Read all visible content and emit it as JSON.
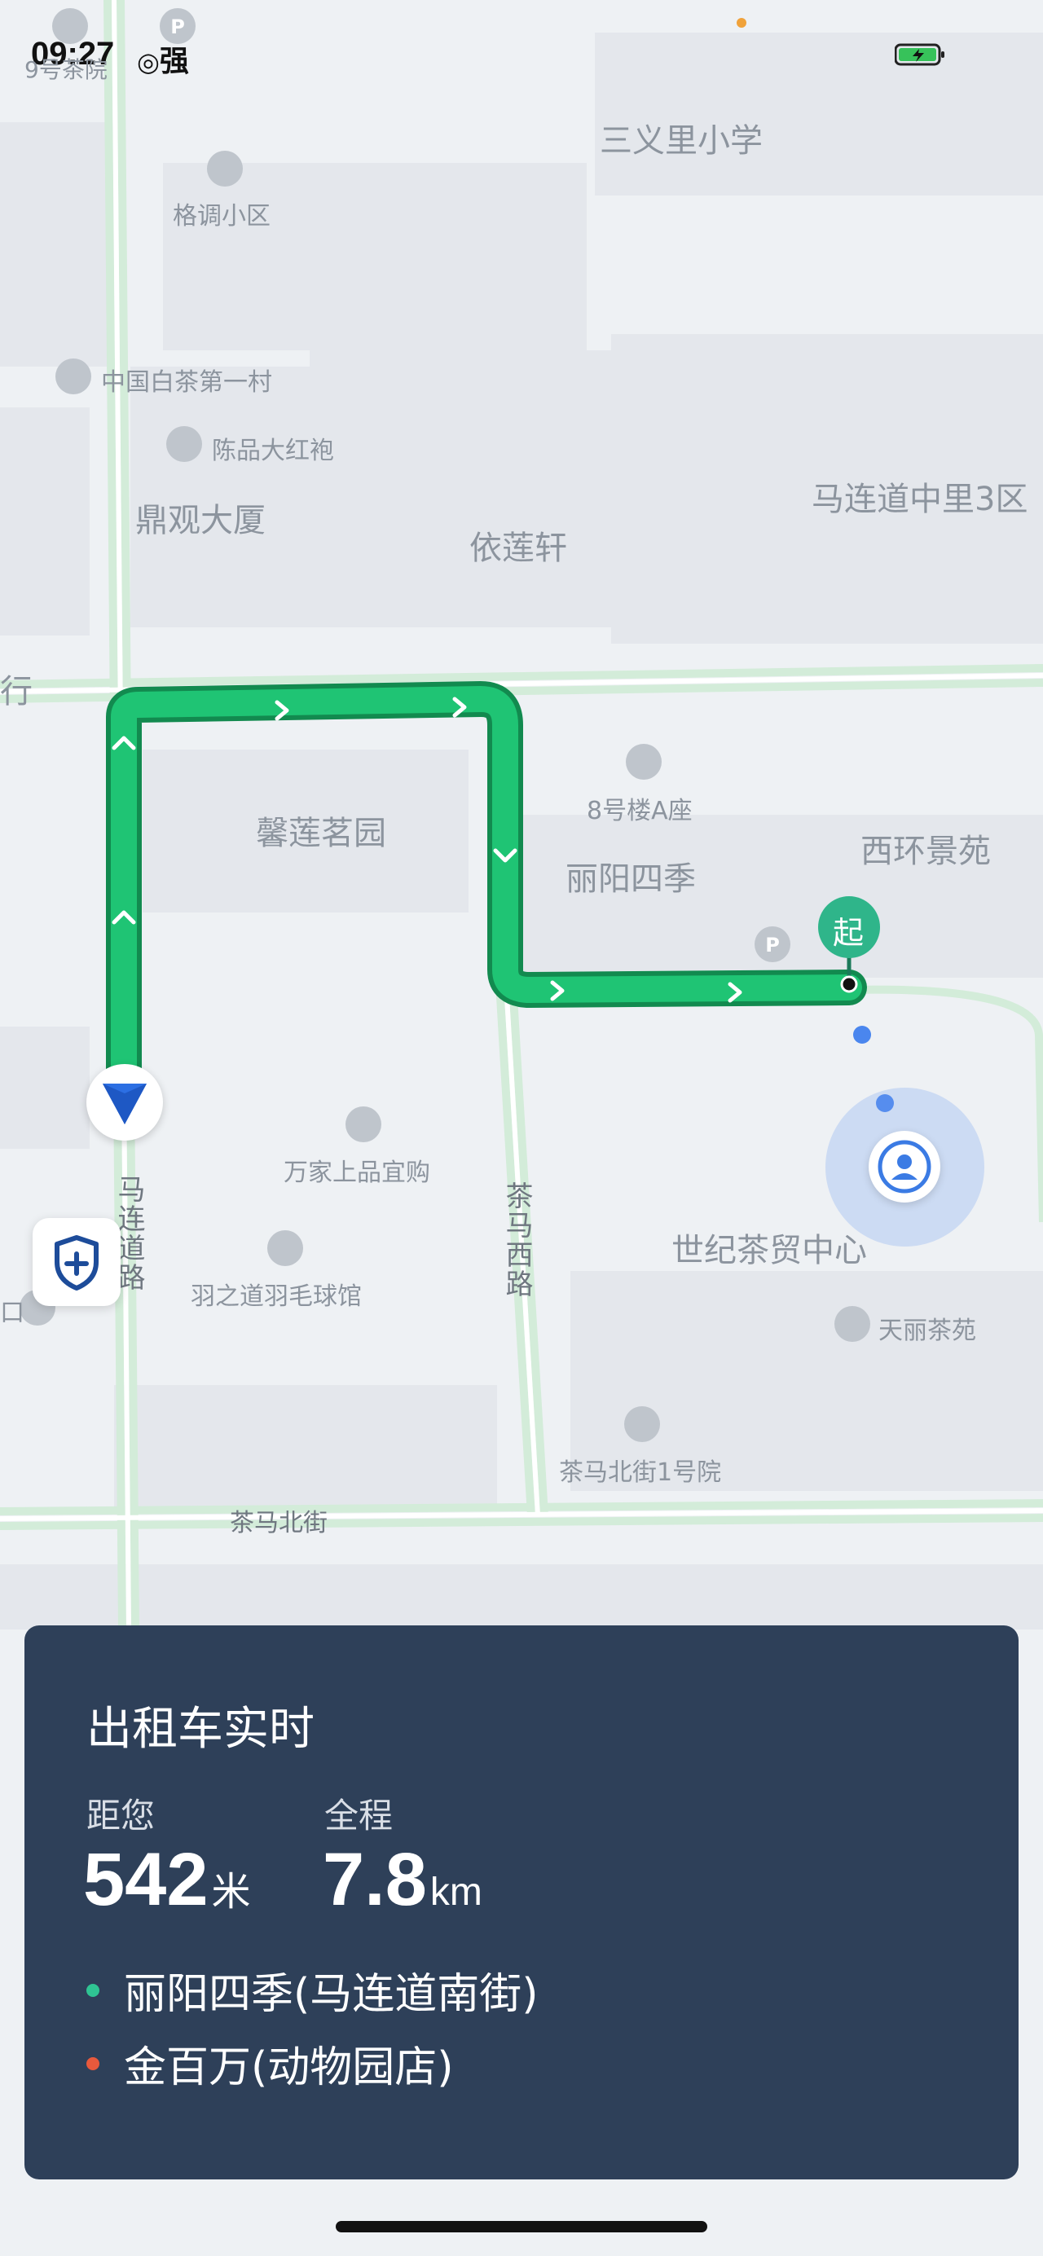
{
  "status_bar": {
    "time": "09:27",
    "signal_label": "强"
  },
  "map": {
    "labels": {
      "school": "三义里小学",
      "gediao": "格调小区",
      "baicha": "中国白茶第一村",
      "chenpin": "陈品大红袍",
      "dingguan": "鼎观大厦",
      "yilianxuan": "依莲轩",
      "maliandao_zhongli": "马连道中里3区",
      "xinlian": "馨莲茗园",
      "building8": "8号楼A座",
      "liyang": "丽阳四季",
      "xihuan": "西环景苑",
      "wanjia": "万家上品宜购",
      "yuzhidao": "羽之道羽毛球馆",
      "shiji": "世纪茶贸中心",
      "tianli": "天丽茶苑",
      "chama_beijie_1": "茶马北街1号院",
      "chama_beijie": "茶马北街",
      "maliandao_road": "马连道路",
      "chama_xilu": "茶马西路",
      "top_left_partial": "9号茶院",
      "edge_left_1": "行",
      "edge_left_2": "口"
    },
    "start_marker": "起",
    "route_color": "#1fc474",
    "vehicle_icon": "navigation-arrow-icon"
  },
  "controls": {
    "safety_icon": "shield-plus-icon",
    "locate_icon": "person-icon"
  },
  "card": {
    "title": "出租车实时",
    "distance_caption": "距您",
    "distance_value": "542",
    "distance_unit": "米",
    "total_caption": "全程",
    "total_value": "7.8",
    "total_unit": "km",
    "pickup": "丽阳四季(马连道南街)",
    "dropoff": "金百万(动物园店)",
    "pickup_color": "#2fc493",
    "dropoff_color": "#e8593c"
  }
}
